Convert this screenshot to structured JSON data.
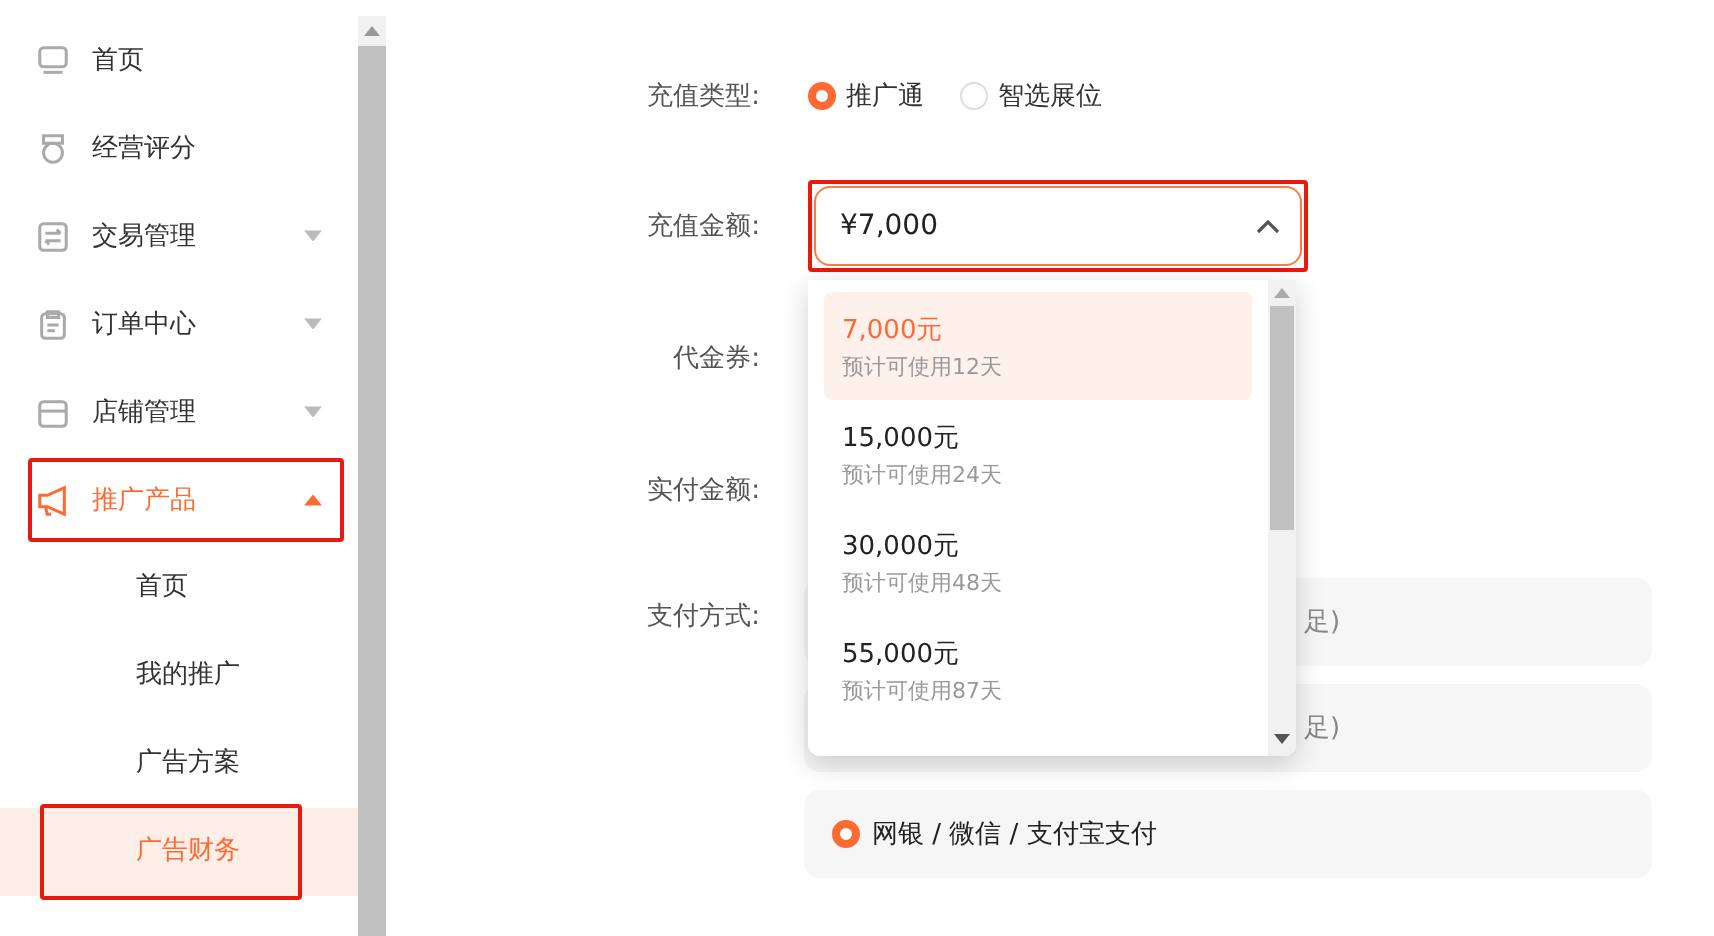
{
  "sidebar": {
    "items": [
      {
        "label": "首页",
        "selected": false,
        "highlighted": false
      },
      {
        "label": "经营评分",
        "selected": false,
        "highlighted": false
      },
      {
        "label": "交易管理",
        "selected": false,
        "highlighted": false,
        "expanded": false
      },
      {
        "label": "订单中心",
        "selected": false,
        "highlighted": false,
        "expanded": false
      },
      {
        "label": "店铺管理",
        "selected": false,
        "highlighted": false,
        "expanded": false
      },
      {
        "label": "推广产品",
        "selected": true,
        "highlighted": true,
        "expanded": true,
        "children": [
          {
            "label": "首页",
            "selected": false,
            "highlighted": false
          },
          {
            "label": "我的推广",
            "selected": false,
            "highlighted": false
          },
          {
            "label": "广告方案",
            "selected": false,
            "highlighted": false
          },
          {
            "label": "广告财务",
            "selected": true,
            "highlighted": true
          }
        ]
      }
    ]
  },
  "form": {
    "recharge_type": {
      "label": "充值类型:",
      "options": [
        {
          "label": "推广通",
          "selected": true
        },
        {
          "label": "智选展位",
          "selected": false
        }
      ]
    },
    "amount": {
      "label": "充值金额:",
      "value": "¥7,000",
      "highlighted": true,
      "expanded": true
    },
    "voucher": {
      "label": "代金券:"
    },
    "paid_amount": {
      "label": "实付金额:"
    },
    "payment": {
      "label": "支付方式:",
      "options": [
        {
          "label": "足)",
          "kind": "covered"
        },
        {
          "label": "足)",
          "kind": "covered"
        },
        {
          "label": "网银 / 微信 / 支付宝支付",
          "kind": "radio",
          "selected": true
        }
      ]
    }
  },
  "dropdown": {
    "options": [
      {
        "amount": "7,000元",
        "note": "预计可使用12天",
        "selected": true
      },
      {
        "amount": "15,000元",
        "note": "预计可使用24天",
        "selected": false
      },
      {
        "amount": "30,000元",
        "note": "预计可使用48天",
        "selected": false
      },
      {
        "amount": "55,000元",
        "note": "预计可使用87天",
        "selected": false
      }
    ]
  }
}
